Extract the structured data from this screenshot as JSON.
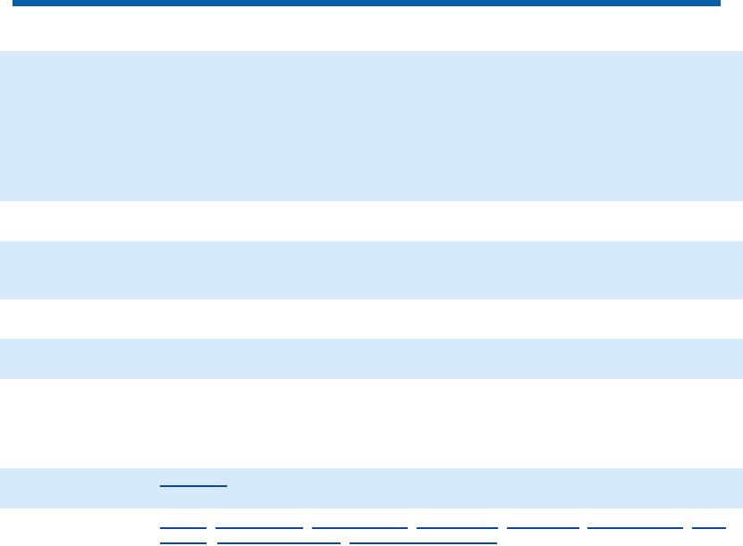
{
  "colors": {
    "header_bar": "#0a5ea8",
    "row_band": "#d7eafc",
    "link": "#0645ad"
  },
  "links": {
    "band_link": "",
    "footer_row_1": [
      "",
      "",
      "",
      "",
      "",
      "",
      ""
    ],
    "footer_row_2": [
      "",
      "",
      ""
    ]
  }
}
